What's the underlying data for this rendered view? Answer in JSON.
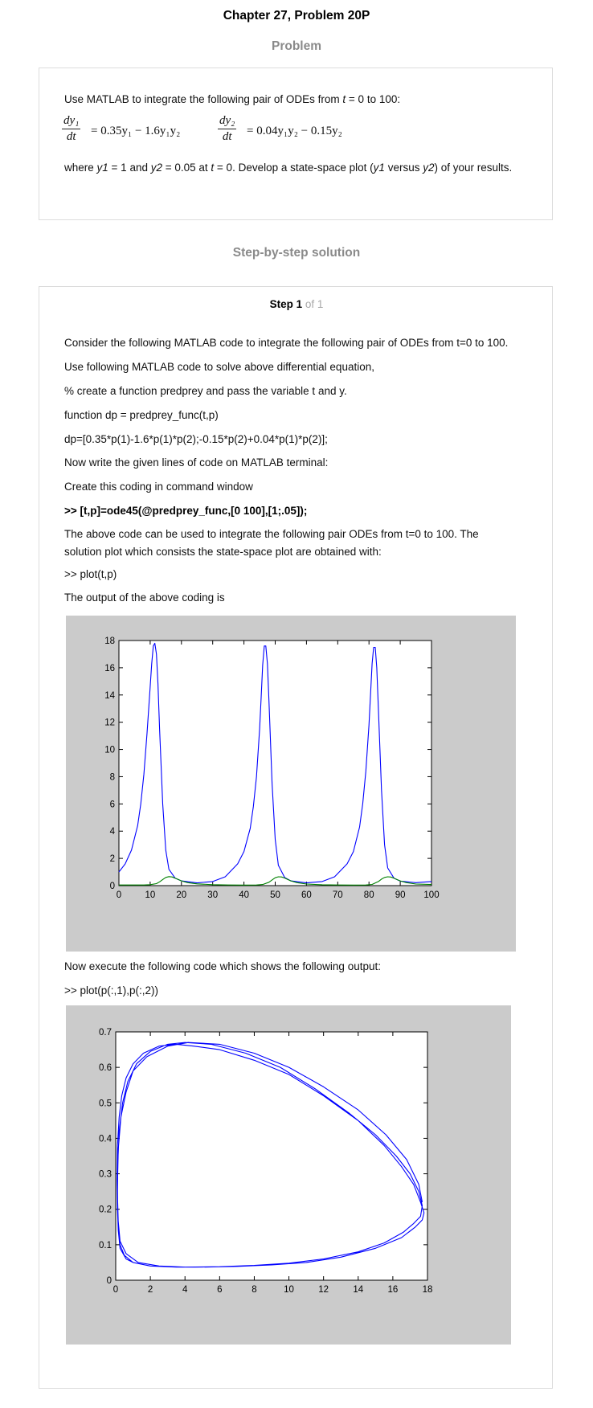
{
  "header": {
    "title": "Chapter 27, Problem 20P",
    "problem_label": "Problem",
    "solution_label": "Step-by-step solution"
  },
  "problem": {
    "intro_a": "Use MATLAB to integrate the following pair of ODEs from ",
    "intro_t": "t",
    "intro_b": " = 0 to 100:",
    "eq1_num": "dy₁",
    "eq1_den": "dt",
    "eq1_rhs": "= 0.35y₁ − 1.6y₁y₂",
    "eq2_num": "dy₂",
    "eq2_den": "dt",
    "eq2_rhs": "= 0.04y₁y₂ − 0.15y₂",
    "where_a": "where ",
    "where_y1": "y1",
    "where_b": " = 1 and ",
    "where_y2": "y2",
    "where_c": " = 0.05 at ",
    "where_t": "t",
    "where_d": " = 0. Develop a state-space plot (",
    "where_y1b": "y1",
    "where_e": " versus ",
    "where_y2b": "y2",
    "where_f": ") of your results."
  },
  "solution": {
    "step_label": "Step 1",
    "step_of": "of 1",
    "lines": [
      "Consider the following MATLAB code to integrate the following pair of ODEs from t=0 to 100.",
      "Use following MATLAB code to solve above differential equation,",
      "% create a function predprey and pass the variable t and y.",
      "function dp = predprey_func(t,p)",
      "dp=[0.35*p(1)-1.6*p(1)*p(2);-0.15*p(2)+0.04*p(1)*p(2)];",
      "Now write the given lines of code on MATLAB terminal:",
      "Create this coding in command window",
      ">> [t,p]=ode45(@predprey_func,[0 100],[1;.05]);",
      "The above code can be used to integrate the following pair ODEs from t=0 to 100. The solution plot which consists the state-space plot are obtained with:",
      ">> plot(t,p)",
      "The output of the above coding is",
      "Now execute the following code which shows the following output:",
      ">> plot(p(:,1),p(:,2))"
    ]
  },
  "chart_data": [
    {
      "type": "line",
      "title": "",
      "xlabel": "",
      "ylabel": "",
      "xlim": [
        0,
        100
      ],
      "ylim": [
        0,
        18
      ],
      "xticks": [
        0,
        10,
        20,
        30,
        40,
        50,
        60,
        70,
        80,
        90,
        100
      ],
      "yticks": [
        0,
        2,
        4,
        6,
        8,
        10,
        12,
        14,
        16,
        18
      ],
      "background": "#cbcbcb",
      "series": [
        {
          "color": "#0000ff",
          "x": [
            0,
            2,
            4,
            6,
            7,
            8,
            9,
            10,
            10.5,
            11,
            11.5,
            12,
            12.5,
            13,
            14,
            15,
            16,
            18,
            20,
            25,
            30,
            34,
            38,
            40,
            42,
            43,
            44,
            45,
            45.5,
            46,
            46.5,
            47,
            47.5,
            48,
            49,
            50,
            51,
            53,
            55,
            60,
            65,
            69,
            73,
            75,
            77,
            78,
            79,
            80,
            80.5,
            81,
            81.5,
            82,
            82.5,
            83,
            84,
            85,
            86,
            88,
            90,
            95,
            100
          ],
          "y": [
            1.0,
            1.6,
            2.6,
            4.4,
            6.0,
            8.2,
            11.2,
            14.6,
            16.3,
            17.6,
            17.8,
            17.0,
            14.8,
            11.5,
            6.0,
            2.6,
            1.2,
            0.55,
            0.35,
            0.2,
            0.3,
            0.65,
            1.6,
            2.5,
            4.2,
            5.8,
            8.0,
            11.5,
            13.8,
            16.2,
            17.6,
            17.6,
            16.3,
            13.6,
            7.5,
            3.4,
            1.5,
            0.6,
            0.35,
            0.2,
            0.3,
            0.65,
            1.6,
            2.5,
            4.3,
            6.0,
            8.4,
            11.8,
            14.0,
            16.3,
            17.5,
            17.5,
            16.0,
            13.0,
            7.0,
            3.0,
            1.3,
            0.55,
            0.33,
            0.22,
            0.3
          ]
        },
        {
          "color": "#008000",
          "x": [
            0,
            5,
            8,
            10,
            12,
            13,
            14,
            15,
            16,
            17,
            18,
            19,
            20,
            22,
            25,
            30,
            35,
            40,
            44,
            46,
            48,
            49,
            50,
            51,
            52,
            53,
            54,
            55,
            57,
            60,
            65,
            70,
            75,
            79,
            81,
            83,
            84,
            85,
            86,
            87,
            88,
            89,
            90,
            92,
            95,
            100
          ],
          "y": [
            0.05,
            0.045,
            0.05,
            0.07,
            0.15,
            0.28,
            0.45,
            0.6,
            0.66,
            0.64,
            0.55,
            0.45,
            0.35,
            0.22,
            0.13,
            0.07,
            0.045,
            0.04,
            0.05,
            0.08,
            0.25,
            0.42,
            0.58,
            0.65,
            0.64,
            0.56,
            0.45,
            0.35,
            0.22,
            0.12,
            0.065,
            0.045,
            0.04,
            0.05,
            0.09,
            0.3,
            0.48,
            0.6,
            0.65,
            0.63,
            0.55,
            0.44,
            0.35,
            0.22,
            0.12,
            0.08
          ]
        }
      ]
    },
    {
      "type": "line",
      "title": "",
      "xlabel": "",
      "ylabel": "",
      "xlim": [
        0,
        18
      ],
      "ylim": [
        0,
        0.7
      ],
      "xticks": [
        0,
        2,
        4,
        6,
        8,
        10,
        12,
        14,
        16,
        18
      ],
      "yticks": [
        0,
        0.1,
        0.2,
        0.3,
        0.4,
        0.5,
        0.6,
        0.7
      ],
      "background": "#cbcbcb",
      "series": [
        {
          "color": "#0000ff",
          "x": [
            1.0,
            0.6,
            0.25,
            0.15,
            0.1,
            0.08,
            0.1,
            0.2,
            0.35,
            0.6,
            1.0,
            1.6,
            2.5,
            3.5,
            4.5,
            6.0,
            8.0,
            10.0,
            12.0,
            14.0,
            15.5,
            16.5,
            17.2,
            17.6,
            17.8,
            17.7,
            17.3,
            16.5,
            15.0,
            13.0,
            11.0,
            9.0,
            7.0,
            5.0,
            3.5,
            2.0,
            1.0,
            0.5,
            0.25,
            0.15,
            0.1,
            0.12,
            0.2,
            0.4,
            0.7,
            1.2,
            2.0,
            3.0,
            4.0,
            5.5,
            7.5,
            9.5,
            11.5,
            13.5,
            15.0,
            16.2,
            17.0,
            17.5,
            17.7,
            17.6,
            17.2,
            16.6,
            15.5,
            14.0,
            12.0,
            10.0,
            8.0,
            6.0,
            4.0,
            2.5,
            1.3,
            0.6,
            0.25,
            0.12,
            0.1,
            0.15,
            0.3,
            0.6,
            1.0,
            1.8,
            3.0,
            4.2,
            6.0,
            8.0,
            10.0,
            12.0,
            14.0,
            15.6,
            16.8,
            17.5,
            17.7
          ],
          "y": [
            0.05,
            0.06,
            0.09,
            0.14,
            0.2,
            0.28,
            0.38,
            0.46,
            0.52,
            0.57,
            0.61,
            0.64,
            0.66,
            0.665,
            0.66,
            0.65,
            0.62,
            0.58,
            0.52,
            0.45,
            0.38,
            0.32,
            0.27,
            0.22,
            0.19,
            0.17,
            0.15,
            0.12,
            0.09,
            0.065,
            0.05,
            0.043,
            0.039,
            0.037,
            0.037,
            0.04,
            0.05,
            0.07,
            0.1,
            0.16,
            0.24,
            0.33,
            0.42,
            0.5,
            0.56,
            0.61,
            0.645,
            0.665,
            0.67,
            0.665,
            0.64,
            0.6,
            0.54,
            0.47,
            0.41,
            0.35,
            0.3,
            0.25,
            0.21,
            0.18,
            0.16,
            0.135,
            0.105,
            0.08,
            0.06,
            0.048,
            0.042,
            0.038,
            0.037,
            0.04,
            0.05,
            0.075,
            0.11,
            0.18,
            0.27,
            0.37,
            0.46,
            0.53,
            0.59,
            0.63,
            0.66,
            0.67,
            0.665,
            0.64,
            0.6,
            0.545,
            0.48,
            0.41,
            0.34,
            0.27,
            0.22
          ]
        }
      ]
    }
  ]
}
